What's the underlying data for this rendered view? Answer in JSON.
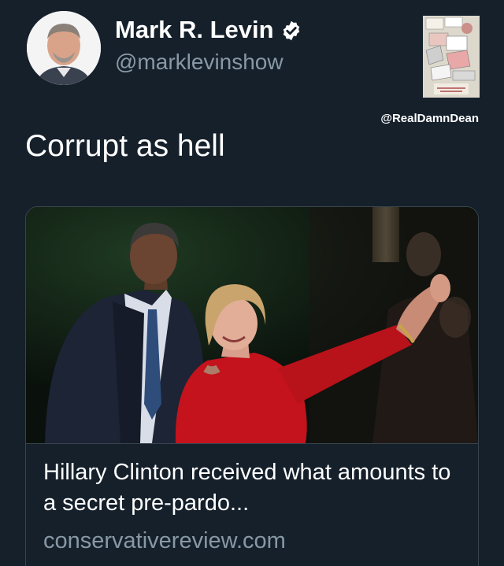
{
  "author": {
    "display_name": "Mark R. Levin",
    "handle": "@marklevinshow",
    "verified": true
  },
  "tweet": {
    "text": "Corrupt as hell"
  },
  "watermark": {
    "handle": "@RealDamnDean"
  },
  "card": {
    "title": "Hillary Clinton received what amounts to a secret pre-pardo...",
    "domain": "conservativereview.com"
  },
  "icons": {
    "verified": "verified-badge-icon"
  },
  "colors": {
    "background": "#15202b",
    "secondary_text": "#8899a6",
    "border": "#38444d"
  }
}
